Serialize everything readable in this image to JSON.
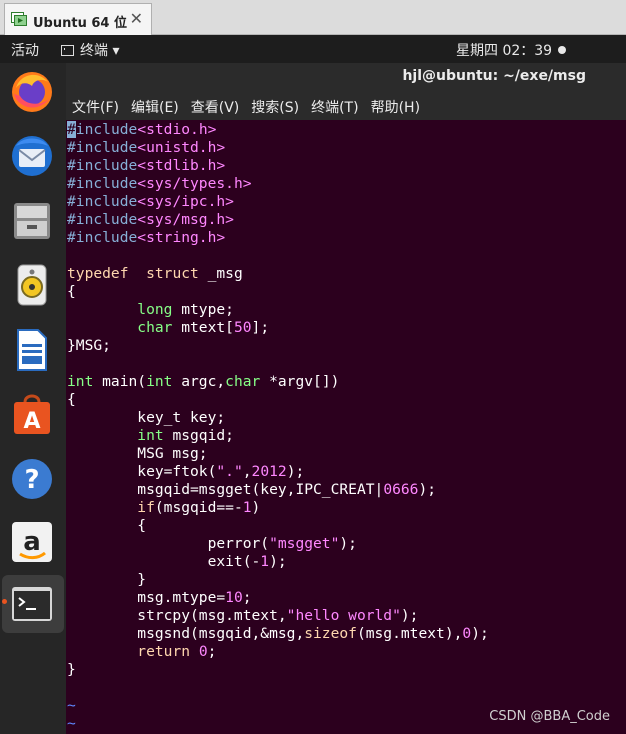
{
  "vm_tab": {
    "title": "Ubuntu 64 位",
    "close": "✕"
  },
  "topbar": {
    "activities": "活动",
    "app_menu": "终端 ▾",
    "clock": "星期四 02：39"
  },
  "dock": {
    "items": [
      "firefox-icon",
      "thunderbird-icon",
      "files-icon",
      "rhythmbox-icon",
      "writer-icon",
      "software-icon",
      "help-icon",
      "amazon-icon",
      "terminal-icon"
    ]
  },
  "terminal": {
    "title": "hjl@ubuntu: ~/exe/msg",
    "menu": [
      "文件(F)",
      "编辑(E)",
      "查看(V)",
      "搜索(S)",
      "终端(T)",
      "帮助(H)"
    ]
  },
  "code_lines": [
    [
      [
        "pp",
        "#"
      ],
      [
        "pp",
        "include"
      ],
      [
        "str",
        "<stdio.h>"
      ]
    ],
    [
      [
        "pp",
        "#include"
      ],
      [
        "str",
        "<unistd.h>"
      ]
    ],
    [
      [
        "pp",
        "#include"
      ],
      [
        "str",
        "<stdlib.h>"
      ]
    ],
    [
      [
        "pp",
        "#include"
      ],
      [
        "str",
        "<sys/types.h>"
      ]
    ],
    [
      [
        "pp",
        "#include"
      ],
      [
        "str",
        "<sys/ipc.h>"
      ]
    ],
    [
      [
        "pp",
        "#include"
      ],
      [
        "str",
        "<sys/msg.h>"
      ]
    ],
    [
      [
        "pp",
        "#include"
      ],
      [
        "str",
        "<string.h>"
      ]
    ],
    [],
    [
      [
        "kw",
        "typedef"
      ],
      [
        "",
        "  "
      ],
      [
        "kw",
        "struct"
      ],
      [
        "",
        " _msg"
      ]
    ],
    [
      [
        "",
        "{"
      ]
    ],
    [
      [
        "",
        "        "
      ],
      [
        "tp",
        "long"
      ],
      [
        "",
        " mtype;"
      ]
    ],
    [
      [
        "",
        "        "
      ],
      [
        "tp",
        "char"
      ],
      [
        "",
        " mtext["
      ],
      [
        "num",
        "50"
      ],
      [
        "",
        "];"
      ]
    ],
    [
      [
        "",
        "}MSG;"
      ]
    ],
    [],
    [
      [
        "tp",
        "int"
      ],
      [
        "",
        " main("
      ],
      [
        "tp",
        "int"
      ],
      [
        "",
        " argc,"
      ],
      [
        "tp",
        "char"
      ],
      [
        "",
        " *argv[])"
      ]
    ],
    [
      [
        "",
        "{"
      ]
    ],
    [
      [
        "",
        "        key_t key;"
      ]
    ],
    [
      [
        "",
        "        "
      ],
      [
        "tp",
        "int"
      ],
      [
        "",
        " msgqid;"
      ]
    ],
    [
      [
        "",
        "        MSG msg;"
      ]
    ],
    [
      [
        "",
        "        key=ftok("
      ],
      [
        "str",
        "\".\""
      ],
      [
        "",
        ","
      ],
      [
        "num",
        "2012"
      ],
      [
        "",
        ");"
      ]
    ],
    [
      [
        "",
        "        msgqid=msgget(key,IPC_CREAT|"
      ],
      [
        "num",
        "0666"
      ],
      [
        "",
        ");"
      ]
    ],
    [
      [
        "",
        "        "
      ],
      [
        "kw",
        "if"
      ],
      [
        "",
        "(msgqid==-"
      ],
      [
        "num",
        "1"
      ],
      [
        "",
        ")"
      ]
    ],
    [
      [
        "",
        "        {"
      ]
    ],
    [
      [
        "",
        "                perror("
      ],
      [
        "str",
        "\"msgget\""
      ],
      [
        "",
        ");"
      ]
    ],
    [
      [
        "",
        "                exit(-"
      ],
      [
        "num",
        "1"
      ],
      [
        "",
        ");"
      ]
    ],
    [
      [
        "",
        "        }"
      ]
    ],
    [
      [
        "",
        "        msg.mtype="
      ],
      [
        "num",
        "10"
      ],
      [
        "",
        ";"
      ]
    ],
    [
      [
        "",
        "        strcpy(msg.mtext,"
      ],
      [
        "str",
        "\"hello world\""
      ],
      [
        "",
        ");"
      ]
    ],
    [
      [
        "",
        "        msgsnd(msgqid,&msg,"
      ],
      [
        "kw",
        "sizeof"
      ],
      [
        "",
        "(msg.mtext),"
      ],
      [
        "num",
        "0"
      ],
      [
        "",
        ");"
      ]
    ],
    [
      [
        "",
        "        "
      ],
      [
        "kw",
        "return"
      ],
      [
        "",
        " "
      ],
      [
        "num",
        "0"
      ],
      [
        "",
        ";"
      ]
    ],
    [
      [
        "",
        "}"
      ]
    ],
    [],
    [
      [
        "tilde",
        "~"
      ]
    ],
    [
      [
        "tilde",
        "~"
      ]
    ]
  ],
  "watermark": "CSDN @BBA_Code"
}
